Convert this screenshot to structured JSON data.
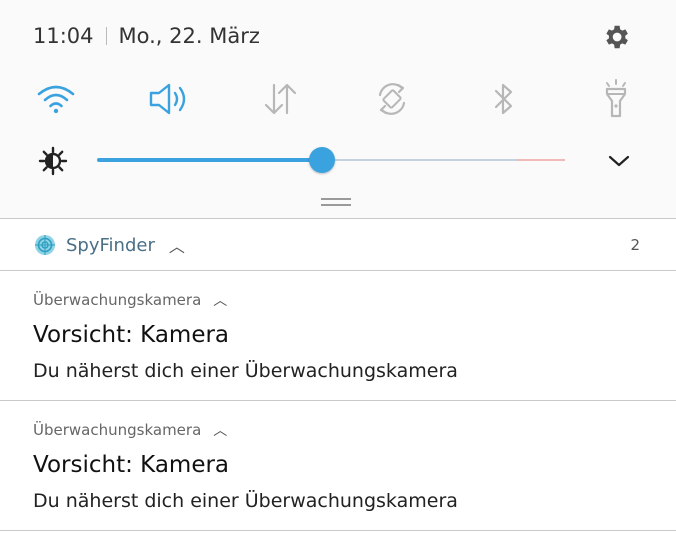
{
  "status": {
    "time": "11:04",
    "date": "Mo., 22. März"
  },
  "quick_settings": [
    {
      "name": "wifi-icon",
      "active": true
    },
    {
      "name": "sound-icon",
      "active": true
    },
    {
      "name": "mobile-data-icon",
      "active": false
    },
    {
      "name": "auto-rotate-icon",
      "active": false
    },
    {
      "name": "bluetooth-icon",
      "active": false
    },
    {
      "name": "flashlight-icon",
      "active": false
    }
  ],
  "brightness": {
    "level": 0.48
  },
  "colors": {
    "accent": "#3aa3df",
    "inactive": "#b7b7b7"
  },
  "group": {
    "app_name": "SpyFinder",
    "count": "2"
  },
  "notifications": [
    {
      "subtitle": "Überwachungskamera",
      "title": "Vorsicht: Kamera",
      "body": "Du näherst dich einer Überwachungskamera"
    },
    {
      "subtitle": "Überwachungskamera",
      "title": "Vorsicht: Kamera",
      "body": "Du näherst dich einer Überwachungskamera"
    }
  ]
}
